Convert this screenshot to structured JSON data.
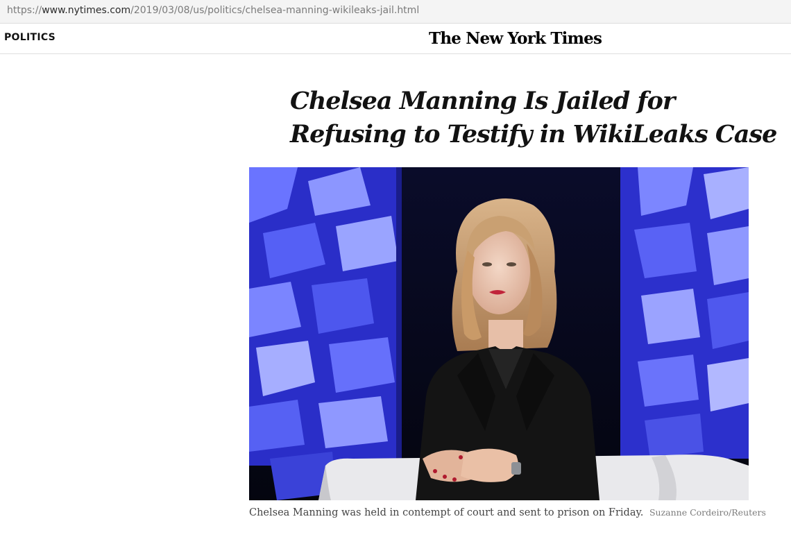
{
  "browser": {
    "url_scheme": "https://",
    "url_host": "www.nytimes.com",
    "url_path": "/2019/03/08/us/politics/chelsea-manning-wikileaks-jail.html"
  },
  "header": {
    "section": "POLITICS",
    "logo": "The New York Times"
  },
  "article": {
    "headline_line1": "Chelsea Manning Is Jailed for",
    "headline_line2": "Refusing to Testify in WikiLeaks Case",
    "caption": "Chelsea Manning was held in contempt of court and sent to prison on Friday.",
    "credit": "Suzanne Cordeiro/Reuters"
  },
  "colors": {
    "stage_blue": "#4a4df0",
    "background_dark": "#060717",
    "jacket": "#141414",
    "text": "#121212"
  }
}
